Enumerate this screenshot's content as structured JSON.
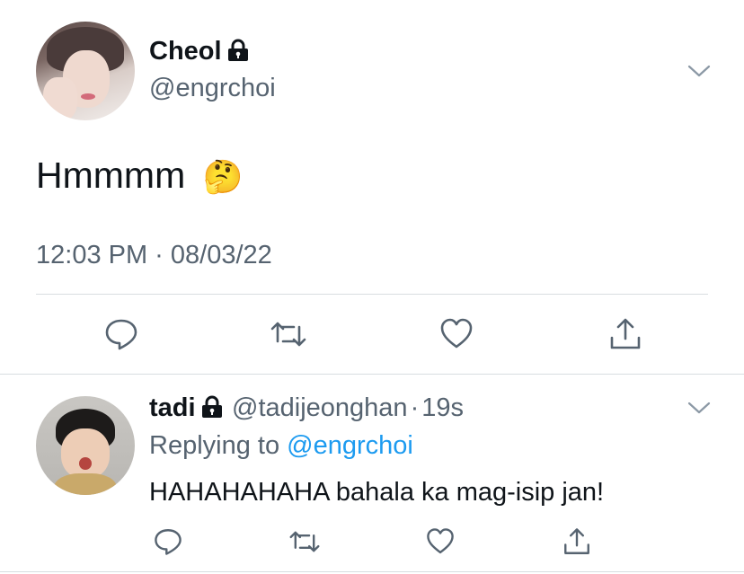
{
  "main_tweet": {
    "author_name": "Cheol",
    "author_handle": "@engrchoi",
    "text": "Hmmmm",
    "emoji": "🤔",
    "timestamp": "12:03 PM · 08/03/22"
  },
  "reply": {
    "author_name": "tadi",
    "author_handle": "@tadijeonghan",
    "separator": "·",
    "age": "19s",
    "replying_prefix": "Replying to",
    "replying_to": "@engrchoi",
    "text": "HAHAHAHAHA bahala ka mag-isip jan!"
  },
  "icons": [
    "lock-icon",
    "chevron-down-icon",
    "reply-icon",
    "retweet-icon",
    "like-icon",
    "share-icon"
  ],
  "colors": {
    "text": "#0f1419",
    "secondary": "#566370",
    "link": "#1d9bf0",
    "divider": "#d8dde1"
  }
}
